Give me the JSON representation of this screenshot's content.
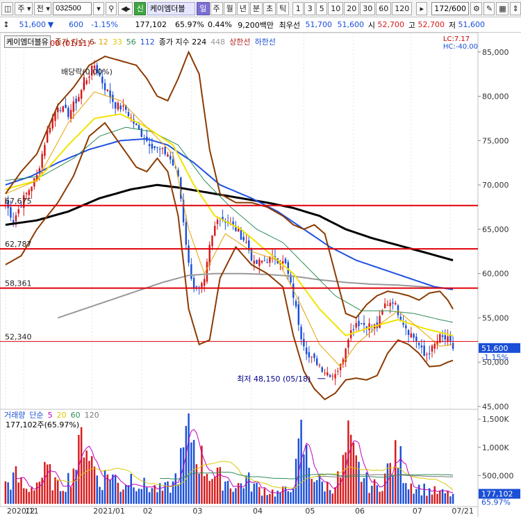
{
  "toolbar": {
    "period_label": "주",
    "all_label": "전",
    "code": "032500",
    "credit_badge": "신",
    "stock_name": "케이엠더블",
    "period_tabs": [
      "일",
      "주",
      "월",
      "년",
      "분",
      "초",
      "틱"
    ],
    "active_tab": "일",
    "interval_tabs": [
      "1",
      "3",
      "5",
      "10",
      "20",
      "30",
      "60",
      "120"
    ],
    "count_value": "172",
    "count_total": "/600"
  },
  "infobar": {
    "price": "51,600",
    "change": "600",
    "change_pct": "-1.15%",
    "volume": "177,102",
    "volume_ratio": "65.97%",
    "turnover_ratio": "0.44%",
    "amount": "9,200백만",
    "best_bid_label": "최우선",
    "best_ask": "51,700",
    "best_bid": "51,600",
    "open_label": "시",
    "open": "52,700",
    "high_label": "고",
    "high": "52,700",
    "low_label": "저",
    "low": "51,600"
  },
  "price_legend": {
    "name": "케이엠더블유",
    "ma_label": "종가 지수",
    "ma_periods": [
      "6",
      "12",
      "33",
      "56",
      "112"
    ],
    "ma224_label": "종가 지수 224",
    "ma448": "448",
    "upper_limit": "상한선",
    "lower_limit": "하한선",
    "lc": "LC:7.17",
    "hc": "HC:-40.00"
  },
  "volume_legend": {
    "label": "거래량",
    "ma_label": "단순",
    "periods": [
      "5",
      "20",
      "60",
      "120"
    ],
    "current": "177,102주(65.97%)"
  },
  "annotations": {
    "high": "최고 86,000 (01/11)",
    "low": "최저 48,150 (05/18)",
    "dividend": "배당락(0.00%)"
  },
  "colors": {
    "up": "#d6191a",
    "down": "#1a4fd6",
    "ma6": "#8b2500",
    "ma12": "#e8a000",
    "ma33": "#f2e300",
    "ma56": "#2e8b57",
    "ma112": "#2050e0",
    "ma224": "#000000",
    "ma448": "#999999",
    "bollinger": "#8b3a00",
    "hline": "#e0000a"
  },
  "chart_data": {
    "type": "candlestick",
    "price_axis": {
      "min": 45000,
      "max": 86000,
      "ticks": [
        85000,
        80000,
        75000,
        70000,
        65000,
        60000,
        55000,
        50000,
        45000
      ]
    },
    "volume_axis": {
      "max": 1600000,
      "ticks": [
        1500000,
        1000000,
        500000
      ],
      "tick_labels": [
        "1,500K",
        "1,000K",
        "500,000"
      ]
    },
    "x_labels": [
      {
        "label": "2020/11",
        "idx": 0
      },
      {
        "label": "12",
        "idx": 7
      },
      {
        "label": "2021/01",
        "idx": 33
      },
      {
        "label": "02",
        "idx": 52
      },
      {
        "label": "03",
        "idx": 71
      },
      {
        "label": "04",
        "idx": 94
      },
      {
        "label": "05",
        "idx": 114
      },
      {
        "label": "06",
        "idx": 133
      },
      {
        "label": "07",
        "idx": 155
      },
      {
        "label": "07/21",
        "idx": 170
      }
    ],
    "horizontal_lines": [
      {
        "value": 67675,
        "label": "67,675",
        "width": 2
      },
      {
        "value": 62787,
        "label": "62,787",
        "width": 2
      },
      {
        "value": 58361,
        "label": "58,361",
        "width": 2
      },
      {
        "value": 52340,
        "label": "52,340",
        "width": 1
      }
    ],
    "close_anchors": [
      [
        0,
        68000
      ],
      [
        3,
        66000
      ],
      [
        7,
        68500
      ],
      [
        12,
        71000
      ],
      [
        16,
        76000
      ],
      [
        20,
        79000
      ],
      [
        24,
        78000
      ],
      [
        28,
        80000
      ],
      [
        31,
        82000
      ],
      [
        34,
        83500
      ],
      [
        38,
        81000
      ],
      [
        42,
        79000
      ],
      [
        46,
        78500
      ],
      [
        50,
        76500
      ],
      [
        54,
        75000
      ],
      [
        58,
        74000
      ],
      [
        62,
        73500
      ],
      [
        66,
        71000
      ],
      [
        68,
        66000
      ],
      [
        70,
        61000
      ],
      [
        72,
        58500
      ],
      [
        74,
        58000
      ],
      [
        76,
        59000
      ],
      [
        78,
        63000
      ],
      [
        81,
        66500
      ],
      [
        84,
        66000
      ],
      [
        88,
        65000
      ],
      [
        92,
        63500
      ],
      [
        95,
        61000
      ],
      [
        99,
        61500
      ],
      [
        103,
        61800
      ],
      [
        107,
        61000
      ],
      [
        110,
        57500
      ],
      [
        113,
        53000
      ],
      [
        116,
        50500
      ],
      [
        119,
        50000
      ],
      [
        122,
        49000
      ],
      [
        125,
        48600
      ],
      [
        128,
        49500
      ],
      [
        131,
        53000
      ],
      [
        134,
        54500
      ],
      [
        138,
        54200
      ],
      [
        142,
        54000
      ],
      [
        145,
        56500
      ],
      [
        148,
        57000
      ],
      [
        151,
        55000
      ],
      [
        154,
        53500
      ],
      [
        157,
        52500
      ],
      [
        160,
        50700
      ],
      [
        163,
        51500
      ],
      [
        166,
        52800
      ],
      [
        169,
        52500
      ],
      [
        171,
        51600
      ]
    ],
    "ma_anchors": {
      "ma12": [
        [
          0,
          69000
        ],
        [
          12,
          70500
        ],
        [
          24,
          77000
        ],
        [
          34,
          80500
        ],
        [
          44,
          79500
        ],
        [
          54,
          76500
        ],
        [
          64,
          73500
        ],
        [
          70,
          65000
        ],
        [
          76,
          60000
        ],
        [
          84,
          64500
        ],
        [
          94,
          62500
        ],
        [
          104,
          61500
        ],
        [
          112,
          57000
        ],
        [
          120,
          52000
        ],
        [
          128,
          49500
        ],
        [
          134,
          52000
        ],
        [
          144,
          54500
        ],
        [
          150,
          55800
        ],
        [
          158,
          53800
        ],
        [
          166,
          51800
        ],
        [
          171,
          52000
        ]
      ],
      "ma33": [
        [
          0,
          69500
        ],
        [
          12,
          70500
        ],
        [
          24,
          74500
        ],
        [
          34,
          77500
        ],
        [
          44,
          78000
        ],
        [
          54,
          76500
        ],
        [
          64,
          74500
        ],
        [
          72,
          70000
        ],
        [
          80,
          66500
        ],
        [
          90,
          65000
        ],
        [
          100,
          62500
        ],
        [
          110,
          60000
        ],
        [
          120,
          56000
        ],
        [
          130,
          53000
        ],
        [
          140,
          54000
        ],
        [
          150,
          54800
        ],
        [
          160,
          53800
        ],
        [
          171,
          53000
        ]
      ],
      "ma56": [
        [
          0,
          70500
        ],
        [
          14,
          71000
        ],
        [
          26,
          73000
        ],
        [
          36,
          75500
        ],
        [
          46,
          76500
        ],
        [
          56,
          76000
        ],
        [
          66,
          74500
        ],
        [
          76,
          70500
        ],
        [
          86,
          67500
        ],
        [
          96,
          65000
        ],
        [
          106,
          63500
        ],
        [
          116,
          60500
        ],
        [
          126,
          57500
        ],
        [
          136,
          55800
        ],
        [
          146,
          55800
        ],
        [
          156,
          55500
        ],
        [
          166,
          54800
        ],
        [
          171,
          54500
        ]
      ],
      "ma112": [
        [
          0,
          70000
        ],
        [
          10,
          71000
        ],
        [
          20,
          72500
        ],
        [
          32,
          74000
        ],
        [
          44,
          75000
        ],
        [
          54,
          75200
        ],
        [
          62,
          74500
        ],
        [
          72,
          72500
        ],
        [
          82,
          70000
        ],
        [
          94,
          68500
        ],
        [
          104,
          67000
        ],
        [
          114,
          65000
        ],
        [
          124,
          63000
        ],
        [
          134,
          61500
        ],
        [
          144,
          60500
        ],
        [
          154,
          59500
        ],
        [
          164,
          58500
        ],
        [
          171,
          58200
        ]
      ],
      "ma224": [
        [
          0,
          65500
        ],
        [
          12,
          66000
        ],
        [
          24,
          67000
        ],
        [
          36,
          68500
        ],
        [
          48,
          69500
        ],
        [
          58,
          70000
        ],
        [
          66,
          69700
        ],
        [
          76,
          69200
        ],
        [
          88,
          68600
        ],
        [
          100,
          68000
        ],
        [
          110,
          67400
        ],
        [
          120,
          66500
        ],
        [
          130,
          65000
        ],
        [
          140,
          64000
        ],
        [
          150,
          63200
        ],
        [
          160,
          62400
        ],
        [
          171,
          61500
        ]
      ],
      "ma448": [
        [
          20,
          55000
        ],
        [
          30,
          56000
        ],
        [
          40,
          57000
        ],
        [
          50,
          58000
        ],
        [
          60,
          59000
        ],
        [
          70,
          59800
        ],
        [
          80,
          60000
        ],
        [
          90,
          60000
        ],
        [
          100,
          59900
        ],
        [
          110,
          59700
        ],
        [
          120,
          59300
        ],
        [
          130,
          59000
        ],
        [
          140,
          58800
        ],
        [
          150,
          58700
        ],
        [
          160,
          58500
        ],
        [
          171,
          58300
        ]
      ],
      "bb_upper": [
        [
          0,
          69000
        ],
        [
          6,
          71500
        ],
        [
          12,
          73500
        ],
        [
          20,
          79000
        ],
        [
          26,
          81000
        ],
        [
          32,
          83500
        ],
        [
          38,
          84500
        ],
        [
          44,
          84000
        ],
        [
          50,
          83500
        ],
        [
          54,
          82000
        ],
        [
          58,
          80000
        ],
        [
          62,
          79500
        ],
        [
          66,
          82000
        ],
        [
          70,
          85000
        ],
        [
          74,
          82500
        ],
        [
          78,
          74000
        ],
        [
          82,
          69000
        ],
        [
          88,
          68000
        ],
        [
          94,
          68000
        ],
        [
          100,
          67500
        ],
        [
          106,
          66500
        ],
        [
          110,
          65500
        ],
        [
          114,
          65000
        ],
        [
          118,
          65500
        ],
        [
          122,
          64500
        ],
        [
          126,
          60000
        ],
        [
          130,
          55500
        ],
        [
          134,
          55000
        ],
        [
          138,
          56500
        ],
        [
          142,
          57500
        ],
        [
          146,
          58000
        ],
        [
          150,
          57800
        ],
        [
          154,
          57500
        ],
        [
          158,
          57000
        ],
        [
          162,
          57800
        ],
        [
          166,
          58000
        ],
        [
          169,
          57000
        ],
        [
          171,
          56000
        ]
      ],
      "bb_lower": [
        [
          0,
          61000
        ],
        [
          6,
          62000
        ],
        [
          12,
          65000
        ],
        [
          20,
          68000
        ],
        [
          26,
          71000
        ],
        [
          32,
          75500
        ],
        [
          38,
          77000
        ],
        [
          44,
          74500
        ],
        [
          50,
          72000
        ],
        [
          54,
          71500
        ],
        [
          58,
          73000
        ],
        [
          62,
          71500
        ],
        [
          66,
          66500
        ],
        [
          70,
          56000
        ],
        [
          74,
          52000
        ],
        [
          78,
          52500
        ],
        [
          82,
          59500
        ],
        [
          88,
          63000
        ],
        [
          94,
          61000
        ],
        [
          100,
          60000
        ],
        [
          106,
          58500
        ],
        [
          110,
          53000
        ],
        [
          114,
          49000
        ],
        [
          118,
          47000
        ],
        [
          122,
          45800
        ],
        [
          126,
          46500
        ],
        [
          130,
          48000
        ],
        [
          134,
          48200
        ],
        [
          138,
          48000
        ],
        [
          142,
          48500
        ],
        [
          146,
          51000
        ],
        [
          150,
          52500
        ],
        [
          154,
          52000
        ],
        [
          158,
          51000
        ],
        [
          162,
          49500
        ],
        [
          166,
          49600
        ],
        [
          169,
          50000
        ],
        [
          171,
          50200
        ]
      ]
    },
    "volume_anchors": [
      [
        0,
        350000
      ],
      [
        4,
        500000
      ],
      [
        8,
        250000
      ],
      [
        12,
        400000
      ],
      [
        16,
        600000
      ],
      [
        20,
        300000
      ],
      [
        24,
        450000
      ],
      [
        28,
        900000
      ],
      [
        30,
        1400000
      ],
      [
        33,
        800000
      ],
      [
        36,
        400000
      ],
      [
        40,
        600000
      ],
      [
        44,
        300000
      ],
      [
        48,
        500000
      ],
      [
        52,
        350000
      ],
      [
        56,
        300000
      ],
      [
        60,
        250000
      ],
      [
        64,
        350000
      ],
      [
        68,
        900000
      ],
      [
        70,
        1500000
      ],
      [
        73,
        1000000
      ],
      [
        76,
        700000
      ],
      [
        80,
        500000
      ],
      [
        84,
        450000
      ],
      [
        88,
        300000
      ],
      [
        92,
        450000
      ],
      [
        96,
        300000
      ],
      [
        100,
        250000
      ],
      [
        104,
        200000
      ],
      [
        108,
        250000
      ],
      [
        111,
        600000
      ],
      [
        113,
        1200000
      ],
      [
        116,
        700000
      ],
      [
        120,
        400000
      ],
      [
        124,
        300000
      ],
      [
        128,
        500000
      ],
      [
        131,
        1100000
      ],
      [
        134,
        700000
      ],
      [
        138,
        400000
      ],
      [
        142,
        300000
      ],
      [
        146,
        600000
      ],
      [
        150,
        900000
      ],
      [
        154,
        400000
      ],
      [
        158,
        300000
      ],
      [
        162,
        250000
      ],
      [
        166,
        200000
      ],
      [
        171,
        177102
      ]
    ]
  }
}
